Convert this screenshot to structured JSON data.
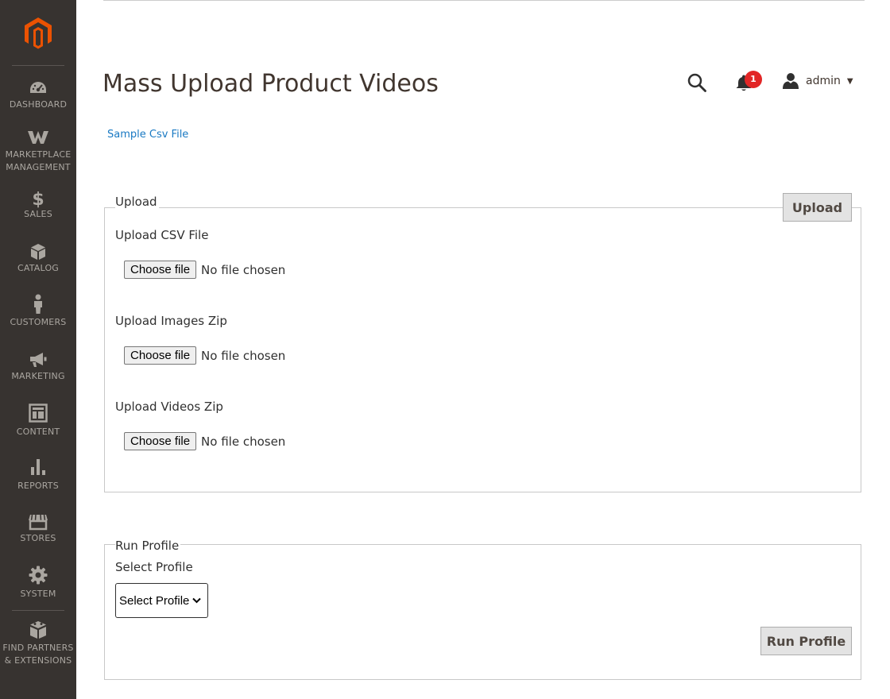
{
  "sidebar": {
    "items": [
      {
        "label": "DASHBOARD",
        "icon": "dashboard-icon"
      },
      {
        "label": "MARKETPLACE\nMANAGEMENT",
        "icon": "marketplace-icon"
      },
      {
        "label": "SALES",
        "icon": "dollar-icon"
      },
      {
        "label": "CATALOG",
        "icon": "box-icon"
      },
      {
        "label": "CUSTOMERS",
        "icon": "person-icon"
      },
      {
        "label": "MARKETING",
        "icon": "megaphone-icon"
      },
      {
        "label": "CONTENT",
        "icon": "layout-icon"
      },
      {
        "label": "REPORTS",
        "icon": "bar-chart-icon"
      },
      {
        "label": "STORES",
        "icon": "storefront-icon"
      },
      {
        "label": "SYSTEM",
        "icon": "gear-icon"
      },
      {
        "label": "FIND PARTNERS\n& EXTENSIONS",
        "icon": "blocks-icon"
      }
    ]
  },
  "header": {
    "title": "Mass Upload Product Videos",
    "notification_count": "1",
    "user_name": "admin"
  },
  "sample_link": "Sample Csv File",
  "upload_section": {
    "legend": "Upload",
    "upload_button": "Upload",
    "fields": [
      {
        "label": "Upload CSV File",
        "button": "Choose file",
        "status": "No file chosen"
      },
      {
        "label": "Upload Images Zip",
        "button": "Choose file",
        "status": "No file chosen"
      },
      {
        "label": "Upload Videos Zip",
        "button": "Choose file",
        "status": "No file chosen"
      }
    ]
  },
  "run_profile_section": {
    "legend": "Run Profile",
    "select_label": "Select Profile",
    "select_value": "Select Profile",
    "run_button": "Run Profile"
  },
  "colors": {
    "sidebar_bg": "#373330",
    "logo_orange": "#eb5202",
    "link_blue": "#1979c3",
    "badge_red": "#e22626"
  }
}
